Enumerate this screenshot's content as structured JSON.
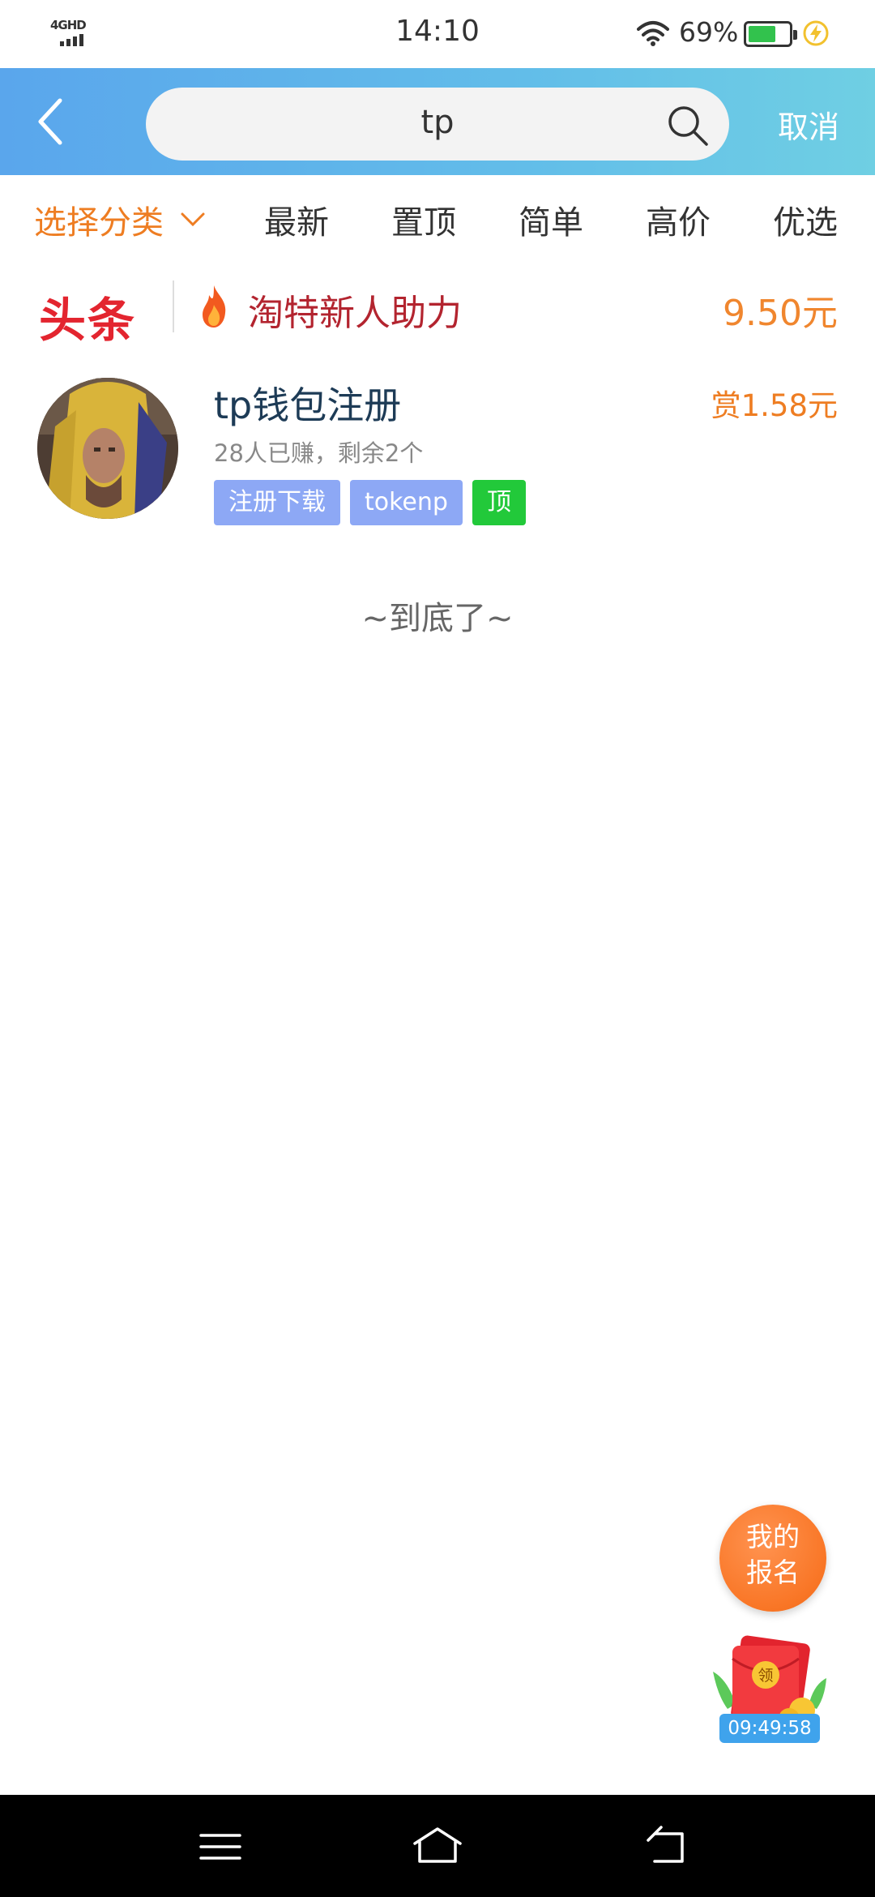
{
  "status_bar": {
    "network": "4GHD",
    "time": "14:10",
    "battery_percent": "69%",
    "battery_level": 0.69
  },
  "header": {
    "search_value": "tp",
    "cancel_label": "取消"
  },
  "filters": {
    "category_label": "选择分类",
    "tabs": [
      "最新",
      "置顶",
      "简单",
      "高价",
      "优选"
    ]
  },
  "headline": {
    "logo_text": "头条",
    "title": "淘特新人助力",
    "price": "9.50元"
  },
  "task": {
    "title": "tp钱包注册",
    "reward": "赏1.58元",
    "meta": "28人已赚，剩余2个",
    "tags": [
      "注册下载",
      "tokenp",
      "顶"
    ]
  },
  "end_text": "~到底了~",
  "floating": {
    "signup_line1": "我的",
    "signup_line2": "报名",
    "redpack_label": "领",
    "redpack_timer": "09:49:58"
  },
  "colors": {
    "accent_orange": "#ee7d22",
    "header_gradient_start": "#5aa6ec",
    "header_gradient_end": "#6fcfe3",
    "headline_red": "#e3252f",
    "tag_blue": "#8da8f5",
    "tag_green": "#22c93a"
  }
}
